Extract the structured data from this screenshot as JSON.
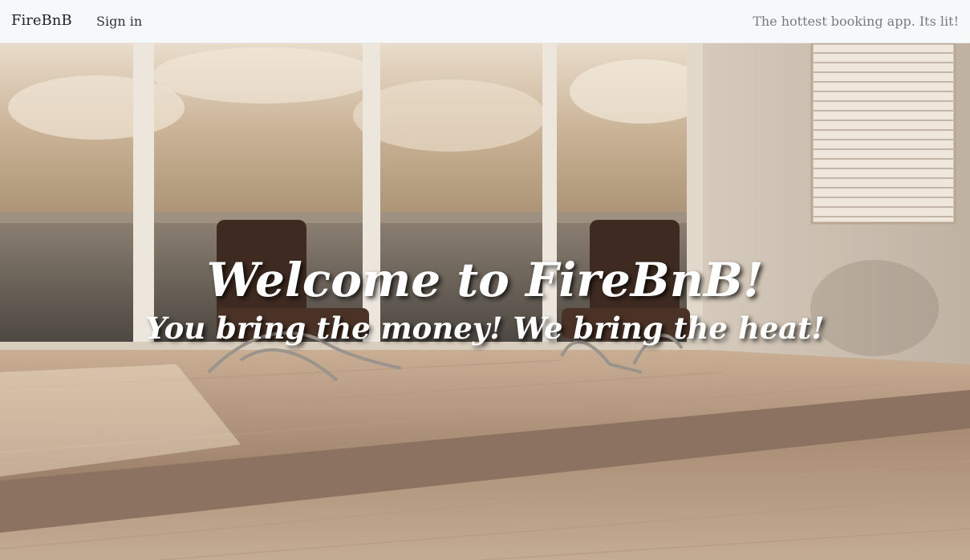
{
  "navbar": {
    "brand": "FireBnB",
    "sign_in": "Sign in",
    "tagline": "The hottest booking app. Its lit!"
  },
  "hero": {
    "title": "Welcome to FireBnB!",
    "subtitle": "You bring the money! We bring the heat!",
    "background_scene": "room-with-city-view-and-chairs"
  },
  "colors": {
    "navbar_bg": "#f7f8fa",
    "tagline_text": "#7a7a7a",
    "hero_text": "#ffffff"
  }
}
